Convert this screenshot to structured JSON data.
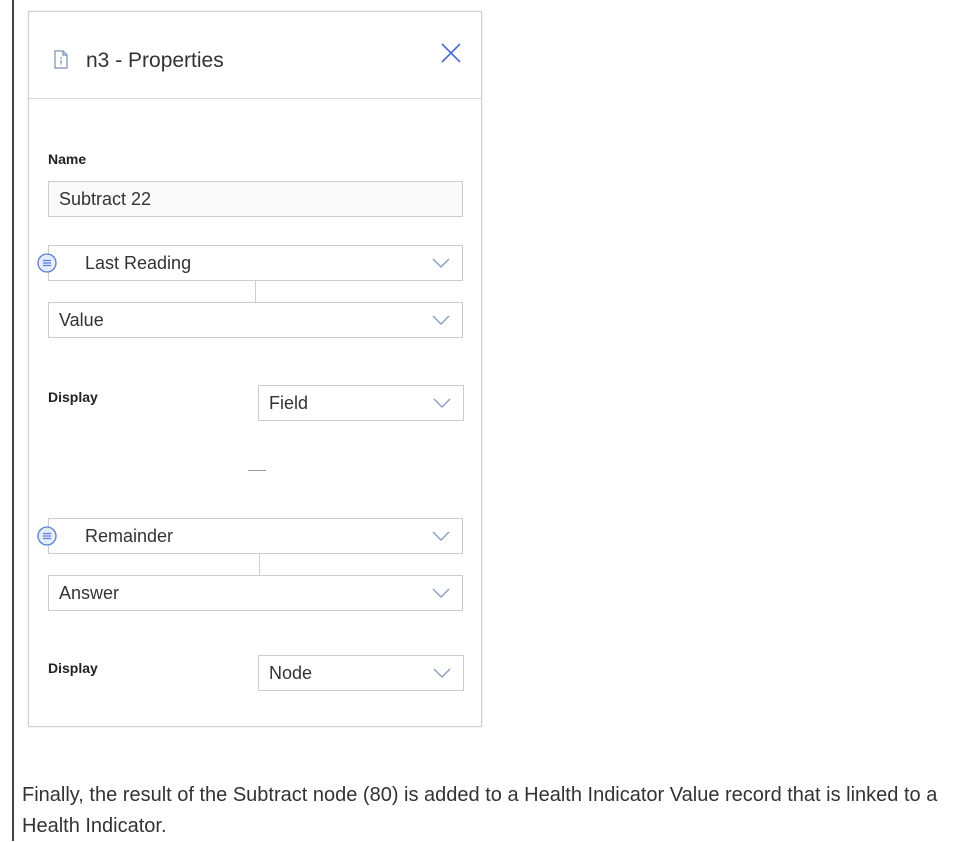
{
  "panel": {
    "title": "n3 - Properties",
    "header_icon": "document-info-icon",
    "close_icon": "close-x-icon",
    "name_label": "Name",
    "name_value": "Subtract 22",
    "operand1": {
      "source": "Last Reading",
      "field": "Value",
      "display_label": "Display",
      "display_value": "Field"
    },
    "operator_symbol": "—",
    "operand2": {
      "source": "Remainder",
      "field": "Answer",
      "display_label": "Display",
      "display_value": "Node"
    },
    "link_icon": "list-circle-icon",
    "chevron_icon": "chevron-down-icon"
  },
  "body_text": "Finally, the result of the Subtract node (80) is added to a Health Indicator Value record that is linked to a Health Indicator.",
  "colors": {
    "accent_blue": "#4a6fd1",
    "icon_gray": "#8f9aa8",
    "border": "#cccccc"
  }
}
